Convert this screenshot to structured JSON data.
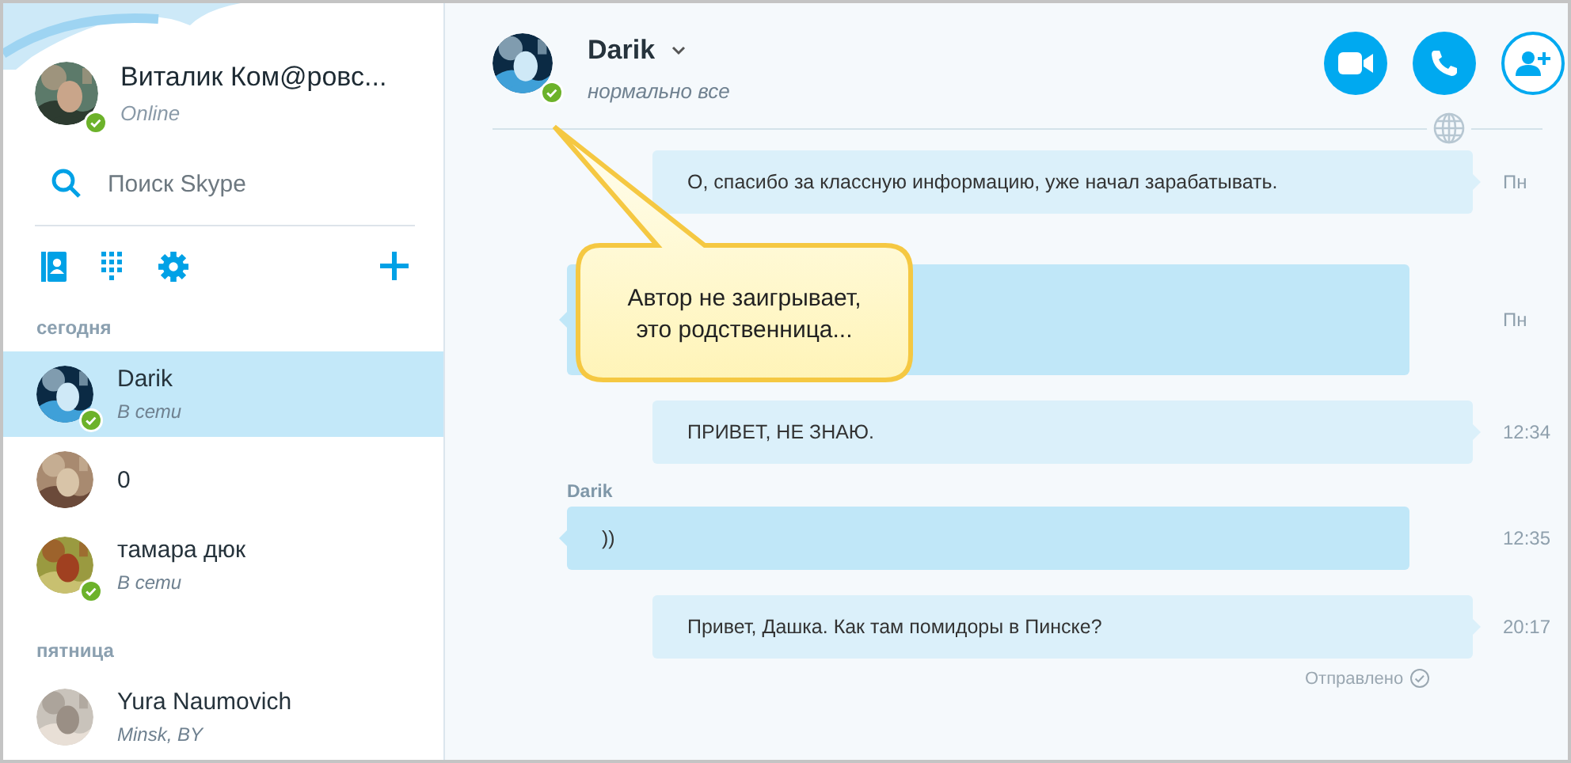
{
  "profile": {
    "name": "Виталик Ком@ровс...",
    "status": "Online",
    "online": true
  },
  "search": {
    "placeholder": "Поиск Skype"
  },
  "sections": [
    {
      "title": "сегодня",
      "contacts": [
        {
          "name": "Darik",
          "status": "В сети",
          "online": true,
          "selected": true
        },
        {
          "name": "0",
          "online": false,
          "selected": false
        },
        {
          "name": "тамара дюк",
          "status": "В сети",
          "online": true,
          "selected": false
        }
      ]
    },
    {
      "title": "пятница",
      "contacts": [
        {
          "name": "Yura Naumovich",
          "status": "Minsk, BY",
          "online": false,
          "selected": false
        }
      ]
    }
  ],
  "chat": {
    "name": "Darik",
    "mood": "нормально все",
    "online": true,
    "messages": [
      {
        "kind": "outgoing",
        "text": "О, спасибо за классную информацию, уже начал зарабатывать.",
        "time": "Пн"
      },
      {
        "kind": "incoming",
        "time": "Пн"
      },
      {
        "kind": "outgoing",
        "text": "ПРИВЕТ, НЕ ЗНАЮ.",
        "time": "12:34"
      },
      {
        "kind": "incoming",
        "sender": "Darik",
        "text": "))",
        "time": "12:35"
      },
      {
        "kind": "outgoing",
        "text": "Привет, Дашка. Как там помидоры в Пинске?",
        "time": "20:17"
      }
    ],
    "delivery": "Отправлено"
  },
  "callout": {
    "text": "Автор не заигрывает, это родственница..."
  }
}
